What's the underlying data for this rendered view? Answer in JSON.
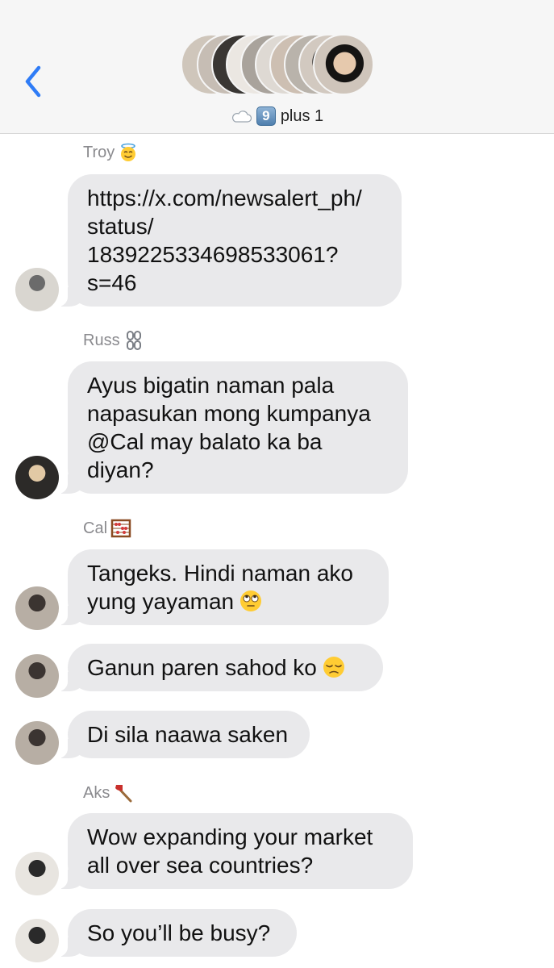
{
  "header": {
    "group_name": "plus 1",
    "group_badge": "9",
    "icons": [
      "back-chevron-icon",
      "cloud-icon",
      "keycap-nine-icon"
    ],
    "accent_color": "#2f7cf6"
  },
  "messages": [
    {
      "sender": "Troy",
      "sender_emoji": "smiling-face-with-halo",
      "text": "https://x.com/newsalert_ph/\nstatus/\n1839225334698533061?\ns=46"
    },
    {
      "sender": "Russ",
      "sender_emoji": "chains",
      "text": "Ayus bigatin naman pala\nnapasukan mong kumpanya\n@Cal may balato ka ba\ndiyan?"
    },
    {
      "sender": "Cal",
      "sender_emoji": "abacus",
      "text": "Tangeks. Hindi naman ako\nyung yayaman",
      "trailing_emoji": "face-with-rolling-eyes"
    },
    {
      "sender": "Cal",
      "text": "Ganun paren sahod ko",
      "trailing_emoji": "pensive-face"
    },
    {
      "sender": "Cal",
      "text": "Di sila naawa saken"
    },
    {
      "sender": "Aks",
      "sender_emoji": "axe",
      "text": "Wow expanding your market\nall over sea countries?"
    },
    {
      "sender": "Aks",
      "text": "So you’ll be busy?"
    }
  ],
  "colors": {
    "bubble": "#e9e9eb",
    "sender_label": "#8a8a8e",
    "header_bg": "#f6f6f6"
  }
}
